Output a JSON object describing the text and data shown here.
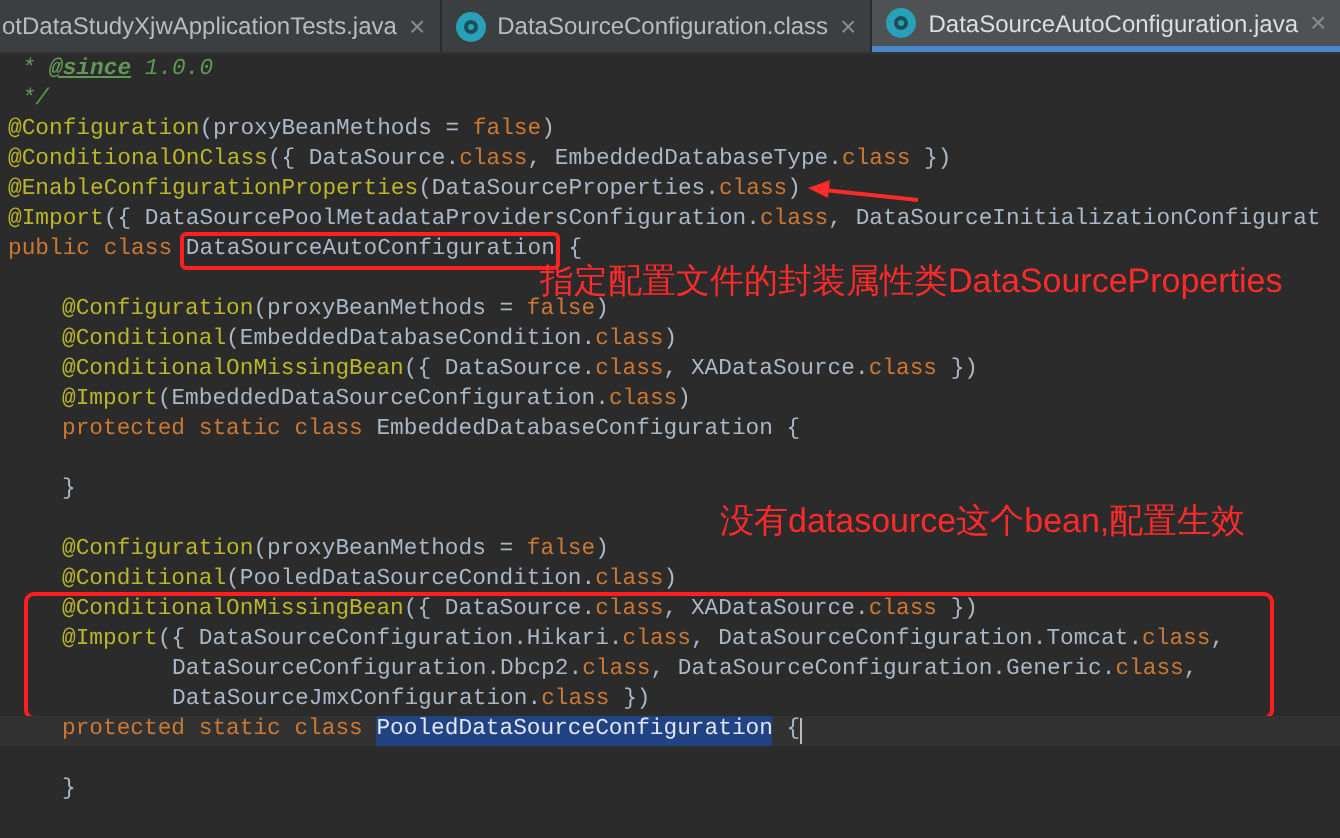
{
  "tabs": [
    {
      "label": "otDataStudyXjwApplicationTests.java",
      "selected": false,
      "icon": false
    },
    {
      "label": "DataSourceConfiguration.class",
      "selected": false,
      "icon": true
    },
    {
      "label": "DataSourceAutoConfiguration.java",
      "selected": true,
      "icon": true
    }
  ],
  "close_glyph": "×",
  "lines": [
    {
      "kind": "top",
      "tokens": [
        {
          "kind": "doc",
          "text": " * "
        },
        {
          "kind": "doctag",
          "text": "@since"
        },
        {
          "kind": "doc",
          "text": " 1.0.0"
        }
      ]
    },
    {
      "kind": "top",
      "tokens": [
        {
          "kind": "doc",
          "text": " */"
        }
      ]
    },
    {
      "kind": "top",
      "tokens": [
        {
          "kind": "annotation",
          "text": "@Configuration"
        },
        {
          "kind": "plain",
          "text": "(proxyBeanMethods = "
        },
        {
          "kind": "keyword",
          "text": "false"
        },
        {
          "kind": "plain",
          "text": ")"
        }
      ]
    },
    {
      "kind": "top",
      "tokens": [
        {
          "kind": "annotation",
          "text": "@ConditionalOnClass"
        },
        {
          "kind": "plain",
          "text": "({ DataSource."
        },
        {
          "kind": "keyword",
          "text": "class"
        },
        {
          "kind": "plain",
          "text": ", EmbeddedDatabaseType."
        },
        {
          "kind": "keyword",
          "text": "class"
        },
        {
          "kind": "plain",
          "text": " })"
        }
      ]
    },
    {
      "kind": "top",
      "tokens": [
        {
          "kind": "annotation",
          "text": "@EnableConfigurationProperties"
        },
        {
          "kind": "plain",
          "text": "(DataSourceProperties."
        },
        {
          "kind": "keyword",
          "text": "class"
        },
        {
          "kind": "plain",
          "text": ")"
        }
      ]
    },
    {
      "kind": "top",
      "tokens": [
        {
          "kind": "annotation",
          "text": "@Import"
        },
        {
          "kind": "plain",
          "text": "({ DataSourcePoolMetadataProvidersConfiguration."
        },
        {
          "kind": "keyword",
          "text": "class"
        },
        {
          "kind": "plain",
          "text": ", DataSourceInitializationConfigurat"
        }
      ]
    },
    {
      "kind": "top",
      "tokens": [
        {
          "kind": "keyword",
          "text": "public class "
        },
        {
          "kind": "plain",
          "text": "DataSourceAutoConfiguration",
          "boxed": true
        },
        {
          "kind": "plain",
          "text": " {"
        }
      ]
    },
    {
      "kind": "blank",
      "note": "指定配置文件的封装属性类DataSourceProperties"
    },
    {
      "kind": "member",
      "tokens": [
        {
          "kind": "annotation",
          "text": "@Configuration"
        },
        {
          "kind": "plain",
          "text": "(proxyBeanMethods = "
        },
        {
          "kind": "keyword",
          "text": "false"
        },
        {
          "kind": "plain",
          "text": ")"
        }
      ]
    },
    {
      "kind": "member",
      "tokens": [
        {
          "kind": "annotation",
          "text": "@Conditional"
        },
        {
          "kind": "plain",
          "text": "(EmbeddedDatabaseCondition."
        },
        {
          "kind": "keyword",
          "text": "class"
        },
        {
          "kind": "plain",
          "text": ")"
        }
      ]
    },
    {
      "kind": "member",
      "tokens": [
        {
          "kind": "annotation",
          "text": "@ConditionalOnMissingBean"
        },
        {
          "kind": "plain",
          "text": "({ DataSource."
        },
        {
          "kind": "keyword",
          "text": "class"
        },
        {
          "kind": "plain",
          "text": ", XADataSource."
        },
        {
          "kind": "keyword",
          "text": "class"
        },
        {
          "kind": "plain",
          "text": " })"
        }
      ]
    },
    {
      "kind": "member",
      "tokens": [
        {
          "kind": "annotation",
          "text": "@Import"
        },
        {
          "kind": "plain",
          "text": "(EmbeddedDataSourceConfiguration."
        },
        {
          "kind": "keyword",
          "text": "class"
        },
        {
          "kind": "plain",
          "text": ")"
        }
      ]
    },
    {
      "kind": "member",
      "tokens": [
        {
          "kind": "keyword",
          "text": "protected static class "
        },
        {
          "kind": "plain",
          "text": "EmbeddedDatabaseConfiguration {"
        }
      ]
    },
    {
      "kind": "blank"
    },
    {
      "kind": "member",
      "tokens": [
        {
          "kind": "plain",
          "text": "}"
        }
      ]
    },
    {
      "kind": "blank",
      "note": "没有datasource这个bean,配置生效"
    },
    {
      "kind": "member",
      "tokens": [
        {
          "kind": "annotation",
          "text": "@Configuration"
        },
        {
          "kind": "plain",
          "text": "(proxyBeanMethods = "
        },
        {
          "kind": "keyword",
          "text": "false"
        },
        {
          "kind": "plain",
          "text": ")"
        }
      ]
    },
    {
      "kind": "member",
      "tokens": [
        {
          "kind": "annotation",
          "text": "@Conditional"
        },
        {
          "kind": "plain",
          "text": "(PooledDataSourceCondition."
        },
        {
          "kind": "keyword",
          "text": "class"
        },
        {
          "kind": "plain",
          "text": ")"
        }
      ]
    },
    {
      "kind": "member",
      "boxed": true,
      "tokens": [
        {
          "kind": "annotation",
          "text": "@ConditionalOnMissingBean"
        },
        {
          "kind": "plain",
          "text": "({ DataSource."
        },
        {
          "kind": "keyword",
          "text": "class"
        },
        {
          "kind": "plain",
          "text": ", XADataSource."
        },
        {
          "kind": "keyword",
          "text": "class"
        },
        {
          "kind": "plain",
          "text": " })"
        }
      ]
    },
    {
      "kind": "member",
      "boxed": true,
      "tokens": [
        {
          "kind": "annotation",
          "text": "@Import"
        },
        {
          "kind": "plain",
          "text": "({ DataSourceConfiguration.Hikari."
        },
        {
          "kind": "keyword",
          "text": "class"
        },
        {
          "kind": "plain",
          "text": ", DataSourceConfiguration.Tomcat."
        },
        {
          "kind": "keyword",
          "text": "class"
        },
        {
          "kind": "plain",
          "text": ","
        }
      ]
    },
    {
      "kind": "continuation",
      "boxed": true,
      "tokens": [
        {
          "kind": "plain",
          "text": "DataSourceConfiguration.Dbcp2."
        },
        {
          "kind": "keyword",
          "text": "class"
        },
        {
          "kind": "plain",
          "text": ", DataSourceConfiguration.Generic."
        },
        {
          "kind": "keyword",
          "text": "class"
        },
        {
          "kind": "plain",
          "text": ","
        }
      ]
    },
    {
      "kind": "continuation",
      "boxed": true,
      "tokens": [
        {
          "kind": "plain",
          "text": "DataSourceJmxConfiguration."
        },
        {
          "kind": "keyword",
          "text": "class"
        },
        {
          "kind": "plain",
          "text": " })"
        }
      ]
    },
    {
      "kind": "member",
      "current": true,
      "tokens": [
        {
          "kind": "keyword",
          "text": "protected static class "
        },
        {
          "kind": "plain",
          "text": "PooledDataSourceConfiguration",
          "selected": true
        },
        {
          "kind": "plain",
          "text": " {"
        }
      ]
    },
    {
      "kind": "blank"
    },
    {
      "kind": "member",
      "tokens": [
        {
          "kind": "plain",
          "text": "}"
        }
      ]
    }
  ]
}
